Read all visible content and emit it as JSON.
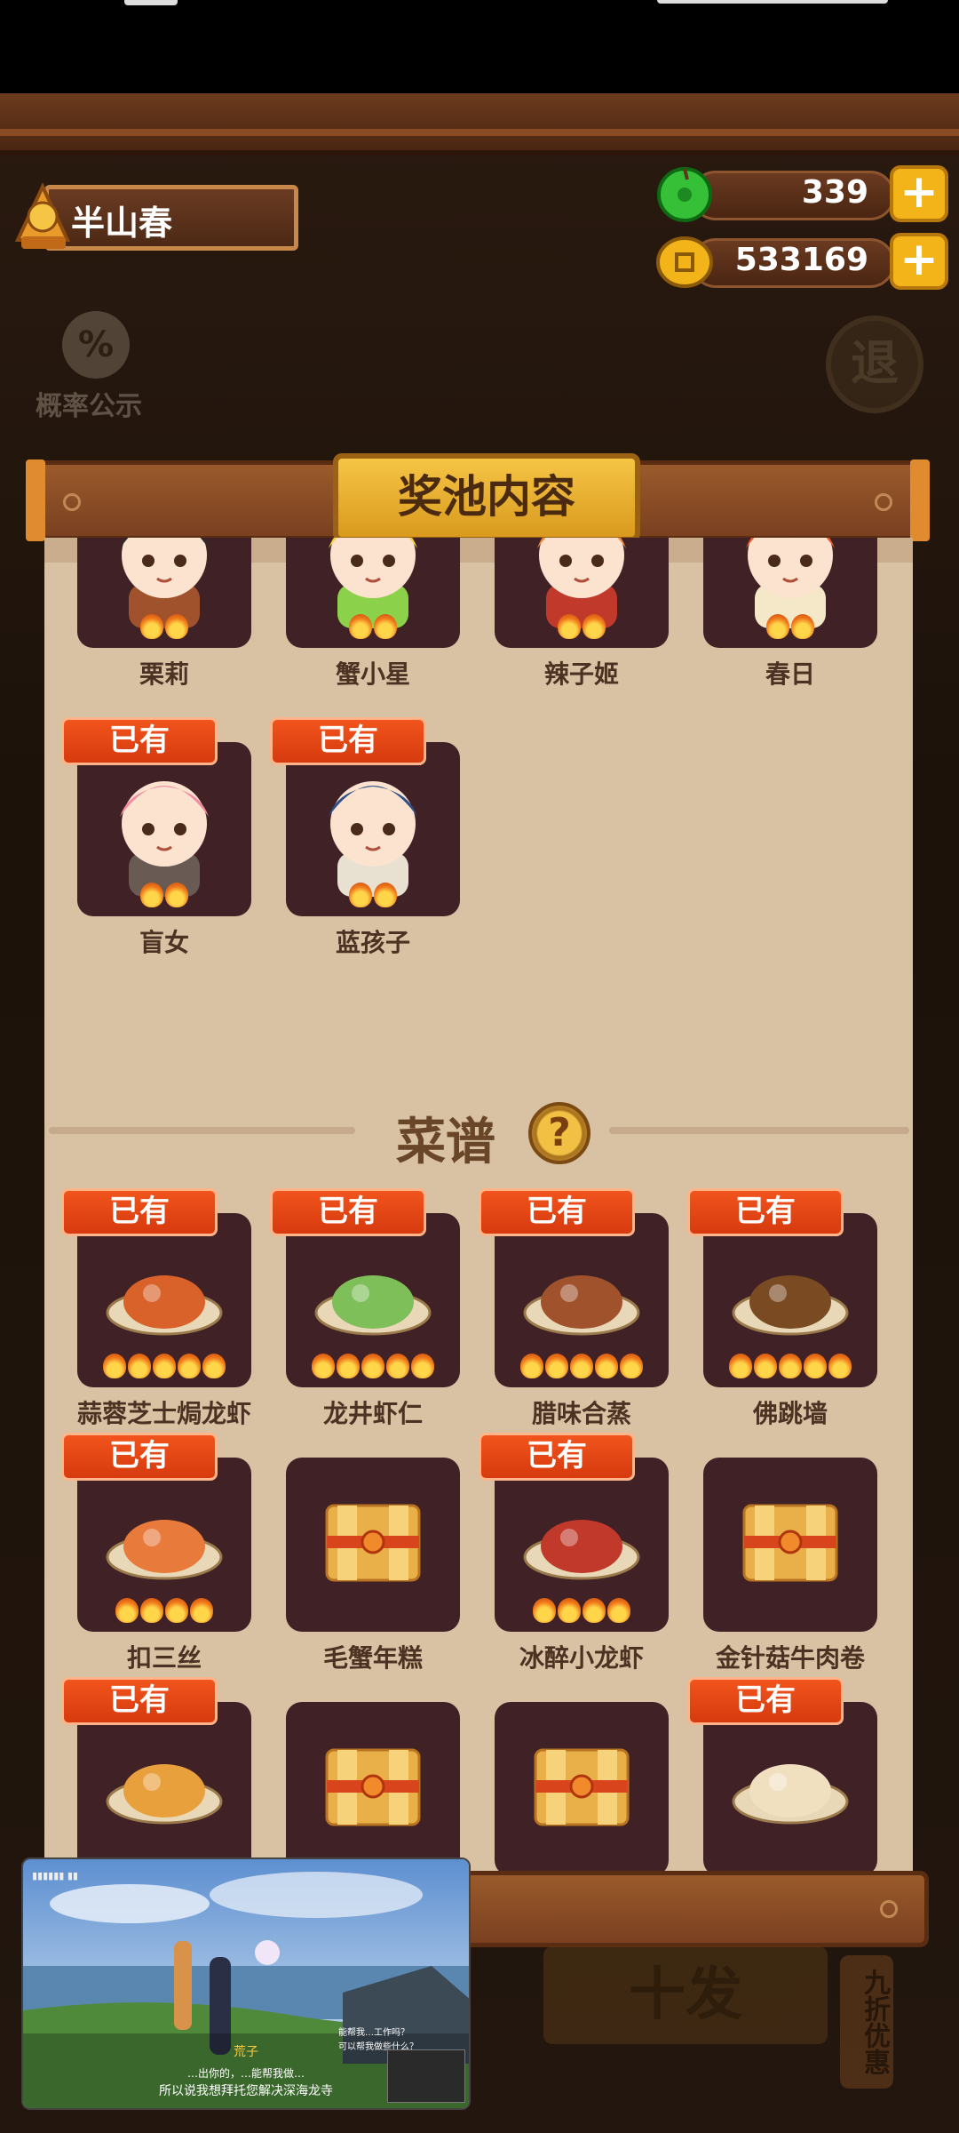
{
  "player": {
    "name": "半山春"
  },
  "currencies": {
    "jade": {
      "value": "339",
      "add": "+"
    },
    "coins": {
      "value": "533169",
      "add": "+"
    }
  },
  "side_buttons": {
    "probability": "概率公示",
    "probability_icon": "%",
    "exit": "退"
  },
  "panel": {
    "title": "奖池内容"
  },
  "characters": [
    {
      "name": "栗莉",
      "owned": false,
      "badge": "",
      "stars": 2,
      "color": "#2b2b2b",
      "accent": "#a0522d"
    },
    {
      "name": "蟹小星",
      "owned": false,
      "badge": "",
      "stars": 2,
      "color": "#f3d13a",
      "accent": "#8bd14a"
    },
    {
      "name": "辣子姬",
      "owned": false,
      "badge": "",
      "stars": 2,
      "color": "#f08a3c",
      "accent": "#c0392b"
    },
    {
      "name": "春日",
      "owned": false,
      "badge": "",
      "stars": 2,
      "color": "#e8572a",
      "accent": "#f5e8c9"
    },
    {
      "name": "盲女",
      "owned": true,
      "badge": "已有",
      "stars": 2,
      "color": "#f28aa0",
      "accent": "#6a5a54"
    },
    {
      "name": "蓝孩子",
      "owned": true,
      "badge": "已有",
      "stars": 2,
      "color": "#2f4f8a",
      "accent": "#e8e0d0"
    }
  ],
  "recipes_section": {
    "title": "菜谱",
    "help_icon": "?"
  },
  "recipes": [
    {
      "name": "蒜蓉芝士焗龙虾",
      "owned": true,
      "badge": "已有",
      "stars": 5,
      "kind": "dish",
      "color": "#d9612a"
    },
    {
      "name": "龙井虾仁",
      "owned": true,
      "badge": "已有",
      "stars": 5,
      "kind": "dish",
      "color": "#7fbf5a"
    },
    {
      "name": "腊味合蒸",
      "owned": true,
      "badge": "已有",
      "stars": 5,
      "kind": "dish",
      "color": "#a0522d"
    },
    {
      "name": "佛跳墙",
      "owned": true,
      "badge": "已有",
      "stars": 5,
      "kind": "dish",
      "color": "#7a4a22"
    },
    {
      "name": "扣三丝",
      "owned": true,
      "badge": "已有",
      "stars": 4,
      "kind": "dish",
      "color": "#e87a3c"
    },
    {
      "name": "毛蟹年糕",
      "owned": false,
      "badge": "",
      "stars": 0,
      "kind": "gift",
      "color": "#e8a03c"
    },
    {
      "name": "冰醉小龙虾",
      "owned": true,
      "badge": "已有",
      "stars": 4,
      "kind": "dish",
      "color": "#c0392b"
    },
    {
      "name": "金针菇牛肉卷",
      "owned": false,
      "badge": "",
      "stars": 0,
      "kind": "gift",
      "color": "#e8a03c"
    },
    {
      "name": "",
      "owned": true,
      "badge": "已有",
      "stars": 0,
      "kind": "dish",
      "color": "#e8a03c"
    },
    {
      "name": "",
      "owned": false,
      "badge": "",
      "stars": 0,
      "kind": "gift",
      "color": "#e8a03c"
    },
    {
      "name": "",
      "owned": false,
      "badge": "",
      "stars": 0,
      "kind": "gift",
      "color": "#e8a03c"
    },
    {
      "name": "",
      "owned": true,
      "badge": "已有",
      "stars": 0,
      "kind": "dish",
      "color": "#f0e0c0"
    }
  ],
  "behind": {
    "draw_button": "十发",
    "promo": "九折优惠"
  },
  "pip_video": {
    "speaker": "荒子",
    "subtitle_small": "…出你的，…能帮我做…",
    "subtitle": "所以说我想拜托您解决深海龙寺",
    "option1": "能帮我…工作吗？",
    "option2": "可以帮我做些什么？"
  }
}
